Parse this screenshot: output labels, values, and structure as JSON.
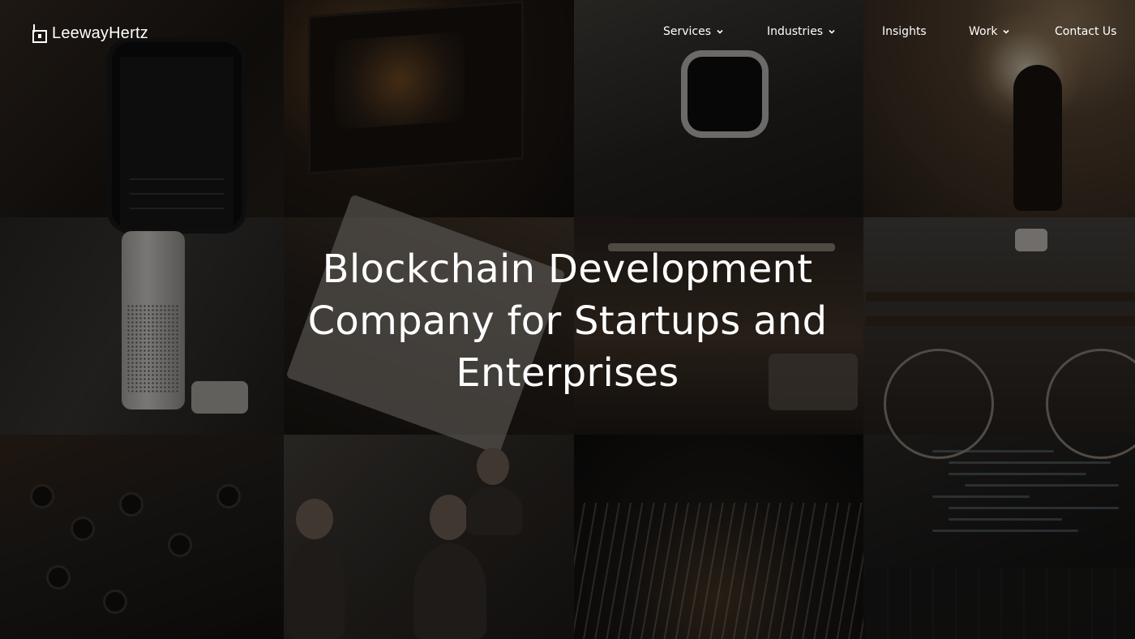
{
  "brand": {
    "name": "LeewayHertz"
  },
  "nav": {
    "items": [
      {
        "label": "Services",
        "has_dropdown": true
      },
      {
        "label": "Industries",
        "has_dropdown": true
      },
      {
        "label": "Insights",
        "has_dropdown": false
      },
      {
        "label": "Work",
        "has_dropdown": true
      },
      {
        "label": "Contact Us",
        "has_dropdown": false
      }
    ]
  },
  "hero": {
    "title": "Blockchain Development Company for Startups and Enterprises"
  },
  "background": {
    "tiles": [
      "smartphone-photo",
      "laptop-photo",
      "smartwatch-photo",
      "runner-photo",
      "smart-speaker-photo",
      "notebook-sketch-photo",
      "living-room-photo",
      "vr-bicycle-photo",
      "circuit-board-photo",
      "team-meeting-photo",
      "city-night-traffic-photo",
      "code-laptop-photo"
    ],
    "overlay_color": "#000000"
  },
  "colors": {
    "text": "#ffffff",
    "overlay": "rgba(0,0,0,0.48)"
  }
}
